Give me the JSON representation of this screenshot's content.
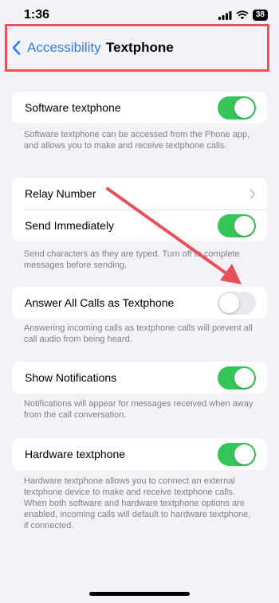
{
  "status_bar": {
    "time": "1:36",
    "battery": "38"
  },
  "nav": {
    "back_label": "Accessibility",
    "title": "Textphone"
  },
  "sections": {
    "software": {
      "label": "Software textphone",
      "enabled": true,
      "note": "Software textphone can be accessed from the Phone app, and allows you to make and receive textphone calls."
    },
    "relay": {
      "relay_label": "Relay Number",
      "send_label": "Send Immediately",
      "send_enabled": true,
      "note": "Send characters as they are typed. Turn off to complete messages before sending."
    },
    "answer": {
      "label": "Answer All Calls as Textphone",
      "enabled": false,
      "note": "Answering incoming calls as textphone calls will prevent all call audio from being heard."
    },
    "notifications": {
      "label": "Show Notifications",
      "enabled": true,
      "note": "Notifications will appear for messages received when away from the call conversation."
    },
    "hardware": {
      "label": "Hardware textphone",
      "enabled": true,
      "note": "Hardware textphone allows you to connect an external textphone device to make and receive textphone calls. When both software and hardware textphone options are enabled, incoming calls will default to hardware textphone, if connected."
    }
  },
  "colors": {
    "accent": "#2f7cf6",
    "toggle_on": "#35c659",
    "highlight": "#e8505b"
  }
}
